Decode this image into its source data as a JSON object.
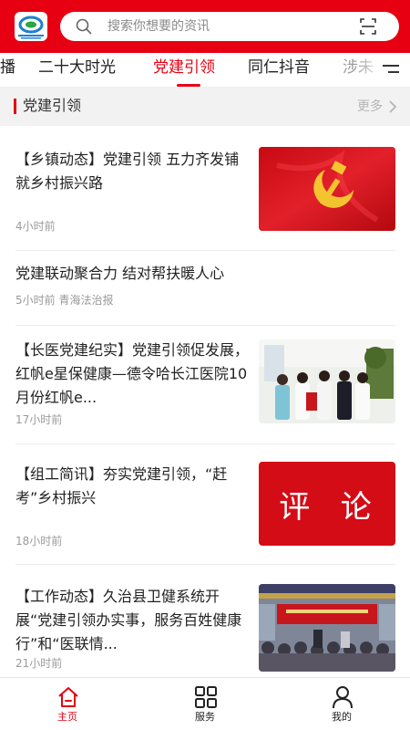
{
  "search": {
    "placeholder": "搜索你想要的资讯"
  },
  "tabs": [
    {
      "label": "播"
    },
    {
      "label": "二十大时光"
    },
    {
      "label": "党建引领",
      "active": true
    },
    {
      "label": "同仁抖音"
    },
    {
      "label": "涉未"
    }
  ],
  "section": {
    "title": "党建引领",
    "more": "更多"
  },
  "articles": [
    {
      "title": "【乡镇动态】党建引领  五力齐发铺就乡村振兴路",
      "meta": "4小时前",
      "image": "party-flag"
    },
    {
      "title": "党建联动聚合力   结对帮扶暖人心",
      "meta": "5小时前  青海法治报"
    },
    {
      "title": "【长医党建纪实】党建引领促发展，红帆e星保健康—德令哈长江医院10月份红帆e...",
      "meta": "17小时前",
      "image": "hospital-staff"
    },
    {
      "title": "【组工简讯】夯实党建引领，“赶考”乡村振兴",
      "meta": "18小时前",
      "image": "comment",
      "image_text": "评  论"
    },
    {
      "title": "【工作动态】久治县卫健系统开展“党建引领办实事，服务百姓健康行”和“医联情...",
      "meta": "21小时前",
      "image": "meeting-hall"
    }
  ],
  "bottom_nav": [
    {
      "label": "主页",
      "icon": "home-icon",
      "active": true
    },
    {
      "label": "服务",
      "icon": "grid-icon"
    },
    {
      "label": "我的",
      "icon": "user-icon"
    }
  ],
  "colors": {
    "brand_red": "#e60012",
    "section_bg": "#f2f2f2"
  }
}
